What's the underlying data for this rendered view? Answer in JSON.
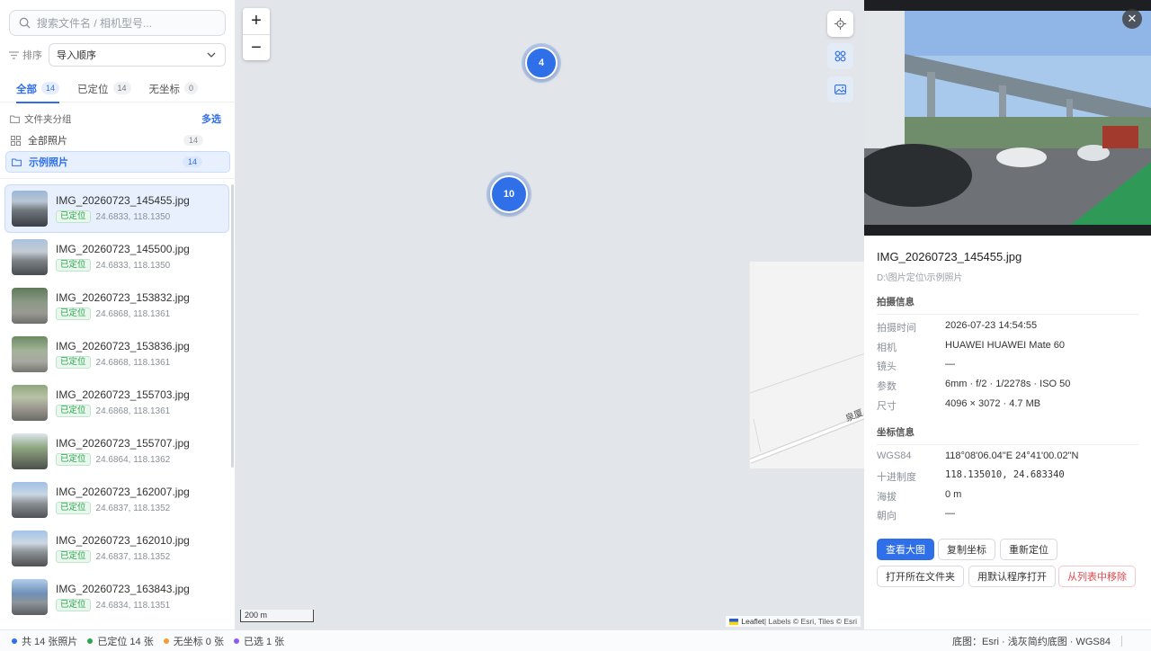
{
  "search": {
    "placeholder": "搜索文件名 / 相机型号..."
  },
  "sort": {
    "label": "排序",
    "value": "导入顺序"
  },
  "tabs": [
    {
      "label": "全部",
      "count": "14"
    },
    {
      "label": "已定位",
      "count": "14"
    },
    {
      "label": "无坐标",
      "count": "0"
    }
  ],
  "groups": {
    "header": "文件夹分组",
    "multi_select": "多选",
    "all": {
      "label": "全部照片",
      "count": "14"
    },
    "selected": {
      "label": "示例照片",
      "count": "14"
    }
  },
  "files": [
    {
      "name": "IMG_20260723_145455.jpg",
      "tag": "已定位",
      "coords": "24.6833, 118.1350"
    },
    {
      "name": "IMG_20260723_145500.jpg",
      "tag": "已定位",
      "coords": "24.6833, 118.1350"
    },
    {
      "name": "IMG_20260723_153832.jpg",
      "tag": "已定位",
      "coords": "24.6868, 118.1361"
    },
    {
      "name": "IMG_20260723_153836.jpg",
      "tag": "已定位",
      "coords": "24.6868, 118.1361"
    },
    {
      "name": "IMG_20260723_155703.jpg",
      "tag": "已定位",
      "coords": "24.6868, 118.1361"
    },
    {
      "name": "IMG_20260723_155707.jpg",
      "tag": "已定位",
      "coords": "24.6864, 118.1362"
    },
    {
      "name": "IMG_20260723_162007.jpg",
      "tag": "已定位",
      "coords": "24.6837, 118.1352"
    },
    {
      "name": "IMG_20260723_162010.jpg",
      "tag": "已定位",
      "coords": "24.6837, 118.1352"
    },
    {
      "name": "IMG_20260723_163843.jpg",
      "tag": "已定位",
      "coords": "24.6834, 118.1351"
    }
  ],
  "map": {
    "zoom_in": "+",
    "zoom_out": "−",
    "clusters": [
      {
        "count": "4"
      },
      {
        "count": "10"
      }
    ],
    "road_label": "泉厦",
    "scale": "200 m",
    "attribution_leaflet": "Leaflet",
    "attribution_rest": " | Labels © Esri, Tiles © Esri"
  },
  "detail": {
    "close": "✕",
    "filename": "IMG_20260723_145455.jpg",
    "path": "D:\\图片定位\\示例照片",
    "shooting_section": "拍摄信息",
    "shooting": [
      {
        "k": "拍摄时间",
        "v": "2026-07-23 14:54:55"
      },
      {
        "k": "相机",
        "v": "HUAWEI HUAWEI Mate 60"
      },
      {
        "k": "镜头",
        "v": "—"
      },
      {
        "k": "参数",
        "v": "6mm · f/2 · 1/2278s · ISO 50"
      },
      {
        "k": "尺寸",
        "v": "4096 × 3072 · 4.7 MB"
      }
    ],
    "coord_section": "坐标信息",
    "coords": [
      {
        "k": "WGS84",
        "v": "118°08'06.04\"E 24°41'00.02\"N"
      },
      {
        "k": "十进制度",
        "v": "118.135010, 24.683340"
      },
      {
        "k": "海拔",
        "v": "0 m"
      },
      {
        "k": "朝向",
        "v": "—"
      }
    ],
    "buttons": {
      "view_large": "查看大图",
      "copy_coords": "复制坐标",
      "relocate": "重新定位",
      "open_folder": "打开所在文件夹",
      "open_default": "用默认程序打开",
      "remove": "从列表中移除"
    }
  },
  "status": {
    "total": "共 14 张照片",
    "located": "已定位 14 张",
    "no_coords": "无坐标 0 张",
    "selected": "已选 1 张",
    "basemap": "底图：Esri · 浅灰简约底图 · WGS84"
  },
  "colors": {
    "accent": "#2f6fe8",
    "located": "#2fa34d",
    "no_coords": "#f0a030",
    "selected": "#8a5cf5",
    "danger": "#e5484d"
  }
}
